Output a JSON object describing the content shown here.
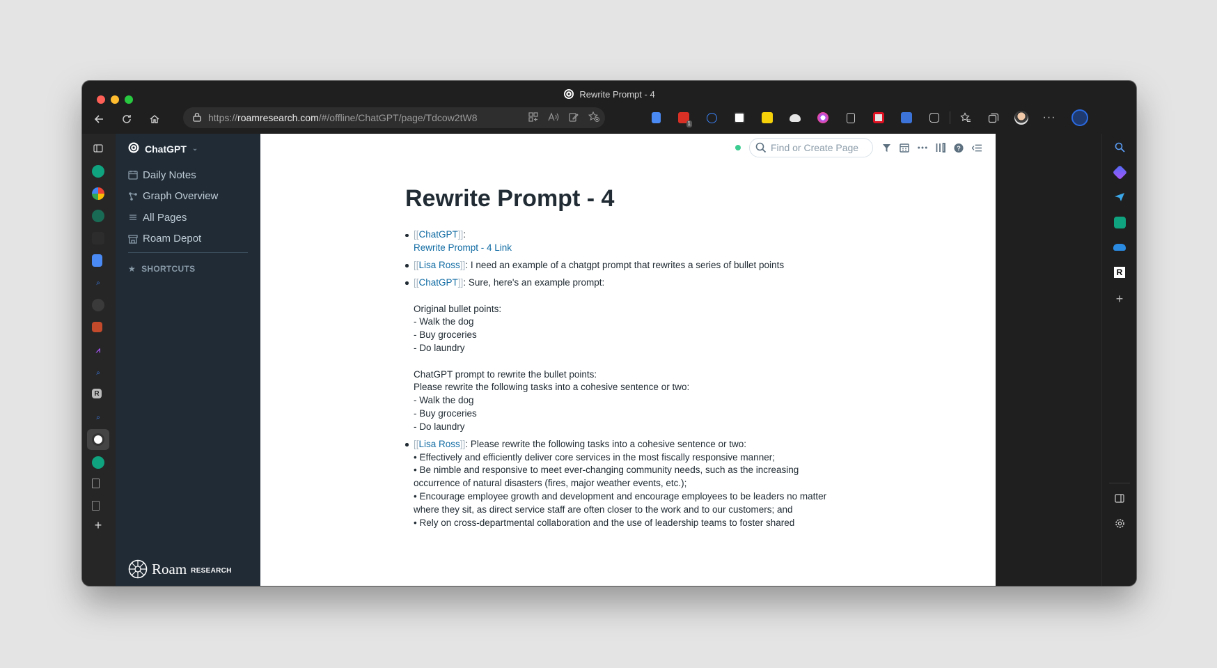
{
  "window": {
    "title": "Rewrite Prompt - 4"
  },
  "browser": {
    "url_prefix": "https://",
    "url_host": "roamresearch.com",
    "url_path": "/#/offline/ChatGPT/page/Tdcow2tW8",
    "extension_badge": "1",
    "colors": {
      "accent_bing": "#2b6be3"
    }
  },
  "sidebar": {
    "graph_name": "ChatGPT",
    "items": [
      {
        "label": "Daily Notes",
        "icon": "calendar-icon"
      },
      {
        "label": "Graph Overview",
        "icon": "graph-icon"
      },
      {
        "label": "All Pages",
        "icon": "list-icon"
      },
      {
        "label": "Roam Depot",
        "icon": "store-icon"
      }
    ],
    "shortcuts_label": "SHORTCUTS",
    "logo_text": "Roam",
    "logo_sub": "RESEARCH"
  },
  "topbar": {
    "search_placeholder": "Find or Create Page",
    "sync_color": "#3dcc91"
  },
  "page": {
    "title": "Rewrite Prompt - 4",
    "blocks": {
      "b1": {
        "ref_open": "[[",
        "ref": "ChatGPT",
        "ref_close": "]]",
        "after": ":",
        "link": "Rewrite Prompt - 4 Link"
      },
      "b2": {
        "ref_open": "[[",
        "ref": "Lisa Ross",
        "ref_close": "]]",
        "after": ": I need an example of a chatgpt prompt that rewrites a series of bullet points"
      },
      "b3": {
        "ref_open": "[[",
        "ref": "ChatGPT",
        "ref_close": "]]",
        "after": ": Sure, here's an example prompt:",
        "lines": [
          "Original bullet points:",
          "- Walk the dog",
          "- Buy groceries",
          "- Do laundry",
          "ChatGPT prompt to rewrite the bullet points:",
          "Please rewrite the following tasks into a cohesive sentence or two:",
          "- Walk the dog",
          "- Buy groceries",
          "- Do laundry"
        ]
      },
      "b4": {
        "ref_open": "[[",
        "ref": "Lisa Ross",
        "ref_close": "]]",
        "after": ": Please rewrite the following tasks into a cohesive sentence or two:",
        "lines": [
          "• Effectively and efficiently deliver core services in the most fiscally responsive manner;",
          "• Be nimble and responsive to meet ever-changing community needs, such as the increasing",
          "occurrence of natural disasters (fires, major weather events, etc.);",
          "• Encourage employee growth and development and encourage employees to be leaders no matter",
          "where they sit, as direct service staff are often closer to the work and to our customers; and",
          "• Rely on cross-departmental collaboration and the use of leadership teams to foster shared"
        ]
      }
    }
  }
}
